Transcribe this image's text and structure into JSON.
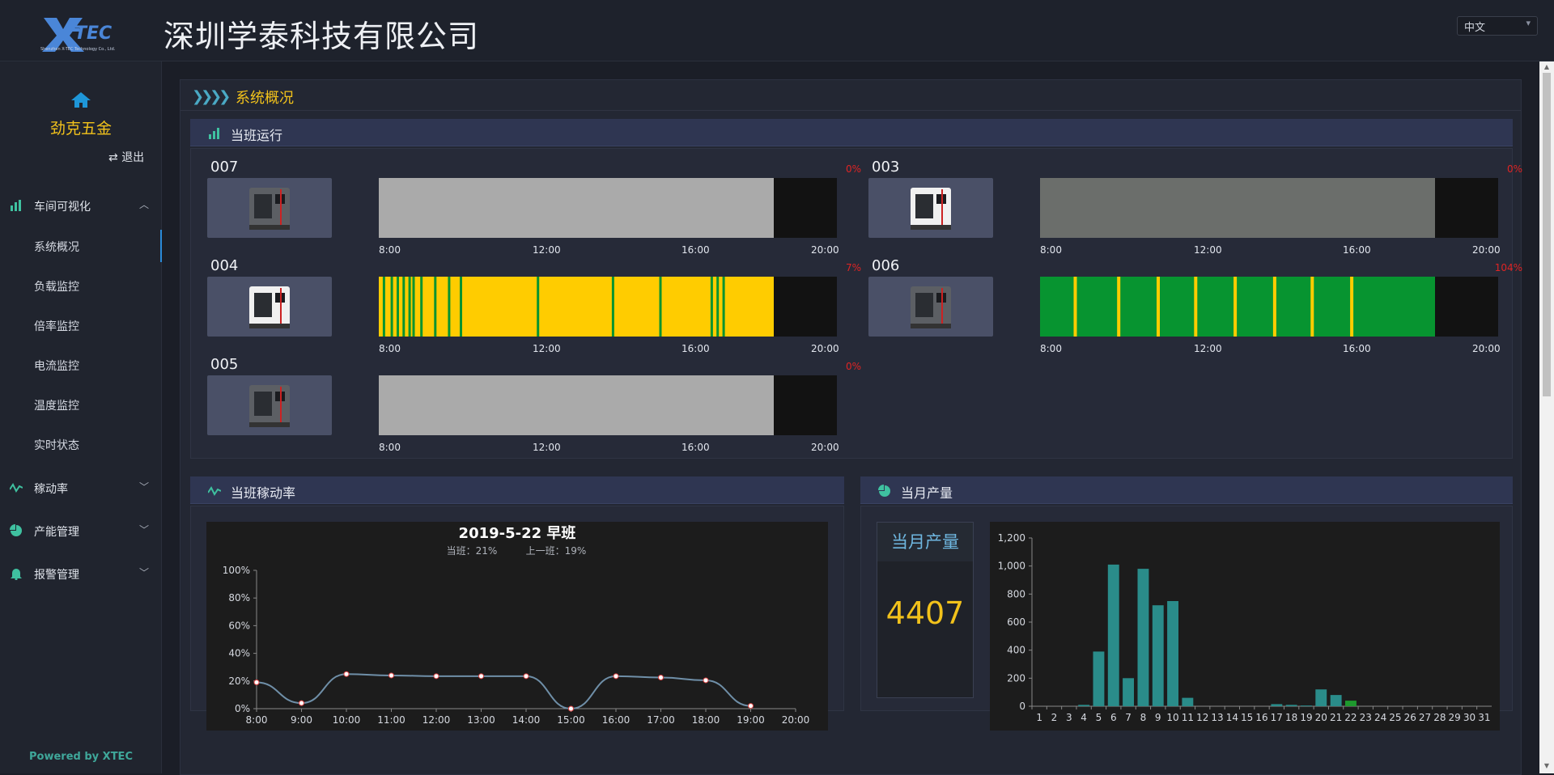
{
  "header": {
    "company": "深圳学泰科技有限公司",
    "logo_text": "X-TEC",
    "logo_subtext": "Shenzhen X-TEC Technology Co., Ltd.",
    "language": "中文"
  },
  "sidebar": {
    "user": "劲克五金",
    "logout": "退出",
    "menu": [
      {
        "label": "车间可视化",
        "icon": "bar-chart-icon",
        "expanded": true
      },
      {
        "label": "稼动率",
        "icon": "activity-icon",
        "expanded": false
      },
      {
        "label": "产能管理",
        "icon": "pie-chart-icon",
        "expanded": false
      },
      {
        "label": "报警管理",
        "icon": "bell-icon",
        "expanded": false
      }
    ],
    "submenu": [
      "系统概况",
      "负载监控",
      "倍率监控",
      "电流监控",
      "温度监控",
      "实时状态"
    ],
    "active_submenu": "系统概况",
    "powered_by": "Powered by XTEC"
  },
  "page": {
    "title": "系统概况"
  },
  "shift_panel": {
    "title": "当班运行",
    "tick_labels": [
      "8:00",
      "12:00",
      "16:00",
      "20:00"
    ],
    "machines": [
      {
        "id": "007",
        "percent": "0%",
        "state": "idle",
        "machine_color": "dark"
      },
      {
        "id": "003",
        "percent": "0%",
        "state": "offline",
        "machine_color": "white"
      },
      {
        "id": "004",
        "percent": "7%",
        "state": "mixed-yellow",
        "machine_color": "white"
      },
      {
        "id": "006",
        "percent": "104%",
        "state": "mixed-green",
        "machine_color": "dark"
      },
      {
        "id": "005",
        "percent": "0%",
        "state": "idle",
        "machine_color": "dark"
      }
    ]
  },
  "utilization_panel": {
    "title": "当班稼动率",
    "chart_title": "2019-5-22   早班",
    "current_label": "当班：21%",
    "previous_label": "上一班：19%"
  },
  "monthly_panel": {
    "title": "当月产量",
    "box_label": "当月产量",
    "total": "4407"
  },
  "colors": {
    "accent": "#f2c21b",
    "idle_gray": "#aaaaaa",
    "offline_gray": "#6b6e6b",
    "running_yellow": "#ffcc00",
    "running_green": "#079430",
    "bar_teal": "#2a8c8a",
    "bar_green": "#1e9a2e"
  },
  "chart_data": [
    {
      "type": "line",
      "title": "2019-5-22   早班",
      "subtitle": "当班：21%   上一班：19%",
      "x": [
        "8:00",
        "9:00",
        "10:00",
        "11:00",
        "12:00",
        "13:00",
        "14:00",
        "15:00",
        "16:00",
        "17:00",
        "18:00",
        "19:00"
      ],
      "x_ticks": [
        "8:00",
        "9:00",
        "10:00",
        "11:00",
        "12:00",
        "13:00",
        "14:00",
        "15:00",
        "16:00",
        "17:00",
        "18:00",
        "19:00",
        "20:00"
      ],
      "y": [
        19,
        4,
        25,
        24,
        23.5,
        23.5,
        23.5,
        0,
        23.5,
        22.5,
        20.5,
        2
      ],
      "y_ticks": [
        "0%",
        "20%",
        "40%",
        "60%",
        "80%",
        "100%"
      ],
      "ylim": [
        0,
        100
      ],
      "grid": false
    },
    {
      "type": "bar",
      "categories": [
        "1",
        "2",
        "3",
        "4",
        "5",
        "6",
        "7",
        "8",
        "9",
        "10",
        "11",
        "12",
        "13",
        "14",
        "15",
        "16",
        "17",
        "18",
        "19",
        "20",
        "21",
        "22",
        "23",
        "24",
        "25",
        "26",
        "27",
        "28",
        "29",
        "30",
        "31"
      ],
      "values": [
        0,
        0,
        0,
        10,
        390,
        1010,
        200,
        980,
        720,
        750,
        60,
        0,
        0,
        0,
        0,
        0,
        15,
        10,
        5,
        120,
        80,
        40,
        0,
        0,
        0,
        0,
        0,
        0,
        0,
        0,
        0
      ],
      "highlight_category": "22",
      "y_ticks": [
        "0",
        "200",
        "400",
        "600",
        "800",
        "1,000",
        "1,200"
      ],
      "ylim": [
        0,
        1200
      ],
      "grid": false
    }
  ]
}
